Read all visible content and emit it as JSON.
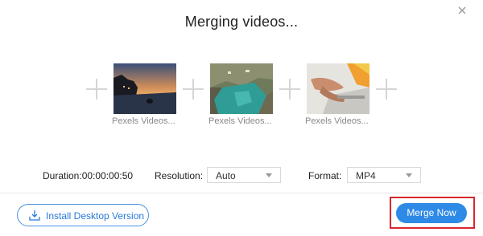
{
  "dialog": {
    "title": "Merging videos..."
  },
  "clips": [
    {
      "name": "Pexels Videos..."
    },
    {
      "name": "Pexels Videos..."
    },
    {
      "name": "Pexels Videos..."
    }
  ],
  "options": {
    "duration_label": "Duration:00:00:00:50",
    "resolution_label": "Resolution:",
    "resolution_value": "Auto",
    "format_label": "Format:",
    "format_value": "MP4"
  },
  "footer": {
    "install_label": "Install Desktop Version",
    "merge_label": "Merge Now"
  },
  "colors": {
    "accent": "#2e8ae6",
    "highlight": "#d8262c"
  },
  "icons": {
    "close": "close-icon",
    "add": "plus-icon",
    "download": "download-icon",
    "dropdown": "chevron-down-icon"
  }
}
